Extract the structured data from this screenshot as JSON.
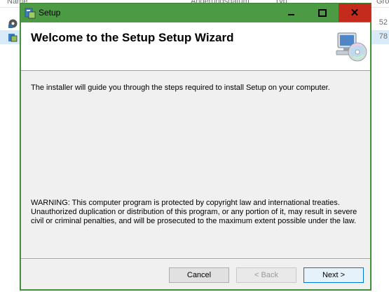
{
  "background_window": {
    "columns": [
      "Name",
      "Änderungsdatum",
      "Typ",
      "Größe"
    ],
    "rows": [
      {
        "icon": "cd-setup-icon",
        "size": "52"
      },
      {
        "icon": "installer-icon",
        "size": "78"
      }
    ]
  },
  "dialog": {
    "title": "Setup",
    "banner_title": "Welcome to the Setup Setup Wizard",
    "banner_icon": "computer-cd-icon",
    "intro": "The installer will guide you through the steps required to install Setup on your computer.",
    "warning": "WARNING: This computer program is protected by copyright law and international treaties. Unauthorized duplication or distribution of this program, or any portion of it, may result in severe civil or criminal penalties, and will be prosecuted to the maximum extent possible under the law.",
    "buttons": {
      "cancel": "Cancel",
      "back": "< Back",
      "next": "Next >"
    },
    "title_buttons": {
      "close": "✕"
    }
  },
  "colors": {
    "titlebar": "#4d9a45",
    "close_button": "#c42b1c",
    "client_background": "#f0f0f0",
    "banner_background": "#ffffff",
    "default_button_border": "#0078d7"
  }
}
